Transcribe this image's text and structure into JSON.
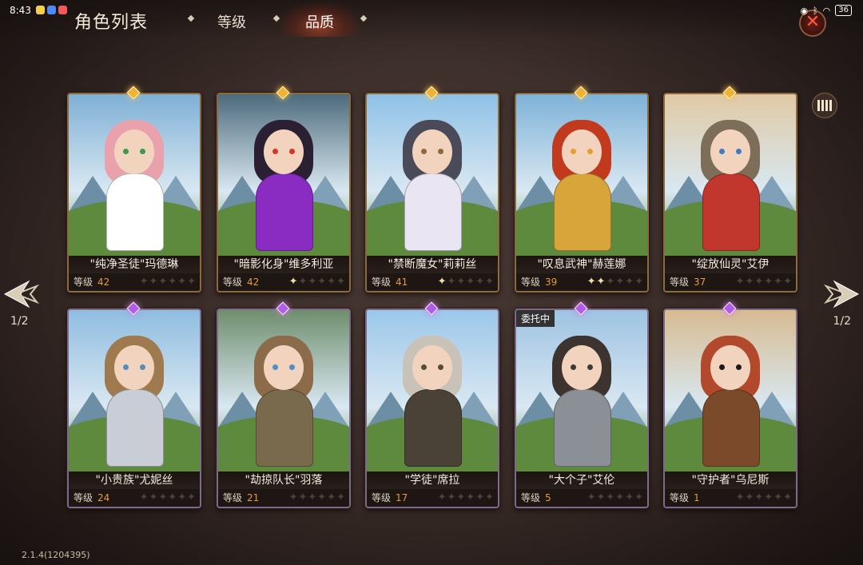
{
  "status_bar": {
    "time": "8:43",
    "battery": "36"
  },
  "header": {
    "title": "角色列表",
    "tabs": [
      {
        "label": "等级"
      },
      {
        "label": "品质"
      }
    ],
    "active_tab": "品质"
  },
  "pagination": {
    "left": "1/2",
    "right": "1/2"
  },
  "level_label": "等级",
  "cards": [
    {
      "name": "\"纯净圣徒\"玛德琳",
      "level": "42",
      "rarity": "gold",
      "stars": 0,
      "hair": "#e9a1ac",
      "outfit": "#ffffff",
      "eyes": "#3c9a4a",
      "bg": "#7fb0d6"
    },
    {
      "name": "\"暗影化身\"维多利亚",
      "level": "42",
      "rarity": "gold",
      "stars": 1,
      "hair": "#2b1f33",
      "outfit": "#8a2cc2",
      "eyes": "#d9332b",
      "bg": "#4d6b7c"
    },
    {
      "name": "\"禁断魔女\"莉莉丝",
      "level": "41",
      "rarity": "gold",
      "stars": 1,
      "hair": "#4a4a58",
      "outfit": "#e9e5f2",
      "eyes": "#8f6a3a",
      "bg": "#8fc1e6"
    },
    {
      "name": "\"叹息武神\"赫莲娜",
      "level": "39",
      "rarity": "gold",
      "stars": 2,
      "hair": "#c23a1e",
      "outfit": "#d7a53a",
      "eyes": "#e3a12a",
      "bg": "#7eb2d8"
    },
    {
      "name": "\"绽放仙灵\"艾伊",
      "level": "37",
      "rarity": "gold",
      "stars": 0,
      "hair": "#7c6e58",
      "outfit": "#c2372d",
      "eyes": "#3d7cc4",
      "bg": "#e0c9a5"
    },
    {
      "name": "\"小贵族\"尤妮丝",
      "level": "24",
      "rarity": "purple",
      "stars": 0,
      "hair": "#a07a4f",
      "outfit": "#c9ced6",
      "eyes": "#4e8fbf",
      "bg": "#8fbde0"
    },
    {
      "name": "\"劫掠队长\"羽落",
      "level": "21",
      "rarity": "purple",
      "stars": 0,
      "hair": "#8b6b4a",
      "outfit": "#7a6a4d",
      "eyes": "#4c8fca",
      "bg": "#6f8e6d"
    },
    {
      "name": "\"学徒\"席拉",
      "level": "17",
      "rarity": "purple",
      "stars": 0,
      "hair": "#c8c2b8",
      "outfit": "#4a4236",
      "eyes": "#5c4a33",
      "bg": "#9cc7ea"
    },
    {
      "name": "\"大个子\"艾伦",
      "level": "5",
      "rarity": "purple",
      "stars": 0,
      "hair": "#3d3430",
      "outfit": "#8b8f96",
      "eyes": "#3b3b3b",
      "bg": "#9ec3e2",
      "badge": "委托中"
    },
    {
      "name": "\"守护者\"乌尼斯",
      "level": "1",
      "rarity": "purple",
      "stars": 0,
      "hair": "#b2492c",
      "outfit": "#7b4a2a",
      "eyes": "#1b1b1b",
      "bg": "#d7bb91"
    }
  ],
  "version": "2.1.4(1204395)",
  "colors": {
    "level_value": "#e79a3c",
    "gold_gem": "#f0b232",
    "purple_gem": "#b15cf0"
  }
}
